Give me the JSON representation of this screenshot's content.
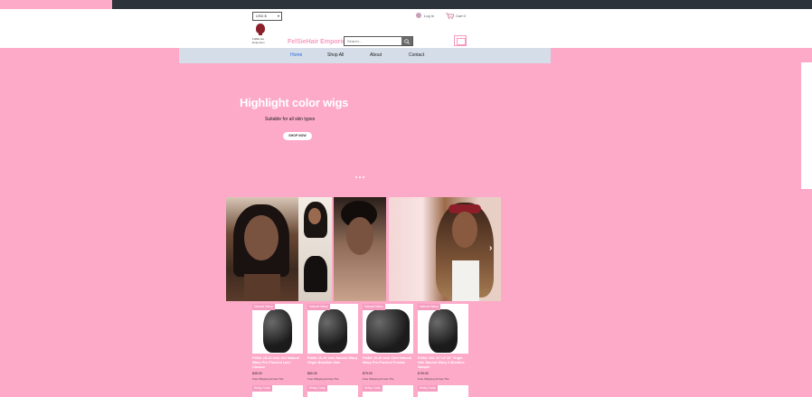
{
  "header": {
    "currency": "USD $",
    "login_label": "Log In",
    "cart_label": "Cart 0",
    "logo_text": "Fel$ie Ha Emporium",
    "brand_name": "FelSieHair Emporium",
    "search_placeholder": "Search..."
  },
  "nav": {
    "items": [
      {
        "label": "Home",
        "active": true
      },
      {
        "label": "Shop All"
      },
      {
        "label": "About"
      },
      {
        "label": "Contact"
      }
    ]
  },
  "hero": {
    "title": "Highlight color wigs",
    "subtitle": "Suitable for all skin types",
    "button_label": "SHOP NOW"
  },
  "products": [
    {
      "tag": "Natural Wavy",
      "name": "Fel$ie 18-22 inch 4x4 Natural Wavy Pre-Plucked Lace Closure",
      "price": "$45.00",
      "shipping": "Free Shipping Across The"
    },
    {
      "tag": "Natural Wavy",
      "name": "Fel$ie 10-30 inch Natural Wavy Virgin Brazilian Hair",
      "price": "$60.00",
      "shipping": "Free Shipping Across The"
    },
    {
      "tag": "Natural Wavy",
      "name": "Fel$ie 10-20 inch 13x4 Natural Wavy Pre-Plucked Frontal",
      "price": "$79.00",
      "shipping": "Free Shipping Across The"
    },
    {
      "tag": "Natural Wavy",
      "name": "Fel$ie 10A 12\"14\"16\" Virgin Hair Natural Wavy 3 Bundles Sample",
      "price": "$ 99.00",
      "shipping": "Free Shipping Across The"
    }
  ],
  "products_row2": [
    {
      "tag": "Kinky Curly"
    },
    {
      "tag": "Kinky Curly"
    },
    {
      "tag": "Kinky Curly"
    },
    {
      "tag": "Kinky Curly"
    }
  ],
  "colors": {
    "page_bg": "#fda9c8",
    "brand_pink": "#f59bbf",
    "nav_bg": "#d5dde8",
    "nav_active": "#2a6bd8",
    "topbar": "#2c333b"
  }
}
